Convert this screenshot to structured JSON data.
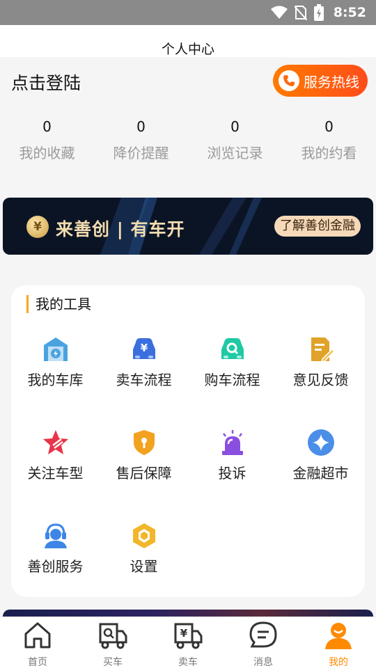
{
  "status_bar": {
    "time": "8:52"
  },
  "header": {
    "title": "个人中心"
  },
  "user": {
    "login_prompt": "点击登陆",
    "hotline_label": "服务热线"
  },
  "stats": [
    {
      "value": "0",
      "label": "我的收藏"
    },
    {
      "value": "0",
      "label": "降价提醒"
    },
    {
      "value": "0",
      "label": "浏览记录"
    },
    {
      "value": "0",
      "label": "我的约看"
    }
  ],
  "banner": {
    "coin_symbol": "¥",
    "slogan": "来善创 | 有车开",
    "cta": "了解善创金融"
  },
  "tools": {
    "heading": "我的工具",
    "items": [
      {
        "label": "我的车库",
        "icon": "garage-icon",
        "color": "#4aa3df"
      },
      {
        "label": "卖车流程",
        "icon": "sell-car-icon",
        "color": "#3b6fe0"
      },
      {
        "label": "购车流程",
        "icon": "buy-car-icon",
        "color": "#20c9a6"
      },
      {
        "label": "意见反馈",
        "icon": "feedback-icon",
        "color": "#e0a22a"
      },
      {
        "label": "关注车型",
        "icon": "star-icon",
        "color": "#e8344a"
      },
      {
        "label": "售后保障",
        "icon": "shield-icon",
        "color": "#f2a21e"
      },
      {
        "label": "投诉",
        "icon": "alarm-icon",
        "color": "#8a4fe0"
      },
      {
        "label": "金融超市",
        "icon": "finance-icon",
        "color": "#4a8ee8"
      },
      {
        "label": "善创服务",
        "icon": "customer-service-icon",
        "color": "#3e86e6"
      },
      {
        "label": "设置",
        "icon": "settings-icon",
        "color": "#f2b62a"
      }
    ]
  },
  "tabbar": {
    "active_color": "#ff8a00",
    "items": [
      {
        "label": "首页",
        "icon": "home-icon"
      },
      {
        "label": "买车",
        "icon": "buy-truck-icon"
      },
      {
        "label": "卖车",
        "icon": "sell-truck-icon"
      },
      {
        "label": "消息",
        "icon": "message-icon"
      },
      {
        "label": "我的",
        "icon": "profile-icon",
        "active": true
      }
    ]
  }
}
